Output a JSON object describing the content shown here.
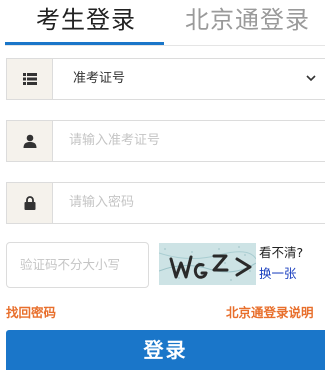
{
  "tabs": {
    "active": "考生登录",
    "inactive": "北京通登录"
  },
  "form": {
    "id_type": {
      "selected": "准考证号",
      "icon": "list-icon"
    },
    "exam_number": {
      "placeholder": "请输入准考证号",
      "icon": "user-icon"
    },
    "password": {
      "placeholder": "请输入密码",
      "icon": "lock-icon"
    },
    "captcha": {
      "placeholder": "验证码不分大小写",
      "image_text": "WGZ>",
      "unclear": "看不清?",
      "refresh": "换一张"
    }
  },
  "links": {
    "forgot_password": "找回密码",
    "beijingtong_help": "北京通登录说明"
  },
  "login_button": "登录",
  "colors": {
    "accent": "#1a76c9",
    "link_orange": "#e86f2c",
    "refresh_link": "#1a3fbf",
    "icon_bg": "#f5f2ec"
  }
}
